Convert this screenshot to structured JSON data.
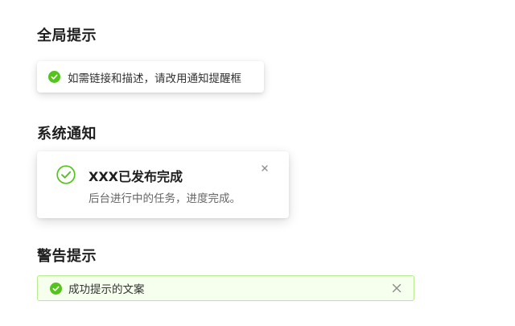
{
  "colors": {
    "success": "#52c41a",
    "alert_bg": "#f6ffed",
    "alert_border": "#b7eb8f",
    "close": "#8c8c8c"
  },
  "global_message": {
    "title": "全局提示",
    "icon": "check-circle-filled-icon",
    "text": "如需链接和描述，请改用通知提醒框"
  },
  "system_notification": {
    "title": "系统通知",
    "icon": "check-circle-outline-icon",
    "heading": "XXX已发布完成",
    "description": "后台进行中的任务，进度完成。",
    "close_icon": "close-icon"
  },
  "warning_alert": {
    "title": "警告提示",
    "icon": "check-circle-filled-icon",
    "text": "成功提示的文案",
    "close_icon": "close-icon"
  }
}
